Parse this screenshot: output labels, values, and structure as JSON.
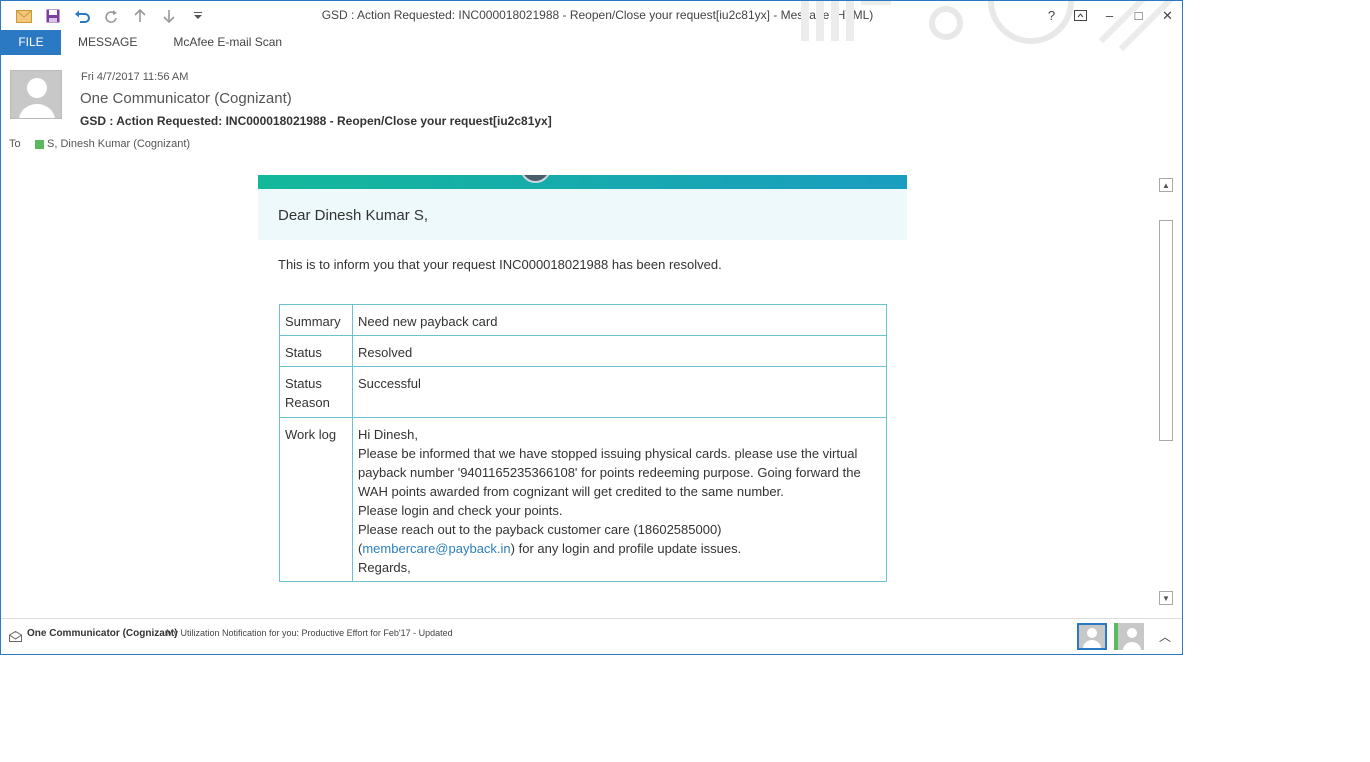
{
  "window": {
    "title": "GSD : Action Requested: INC000018021988 - Reopen/Close your request[iu2c81yx] - Message (HTML)",
    "accent_color": "#2b79c2"
  },
  "quick_access": [
    {
      "icon": "mail-icon"
    },
    {
      "icon": "save-icon"
    },
    {
      "icon": "undo-icon"
    },
    {
      "icon": "redo-icon"
    },
    {
      "icon": "previous-item-icon"
    },
    {
      "icon": "next-item-icon"
    },
    {
      "icon": "customize-toolbar-icon"
    }
  ],
  "window_controls": {
    "help": "?",
    "restore_ribbon_icon": "ribbon-display-icon",
    "minimize": "–",
    "maximize": "□",
    "close": "✕"
  },
  "ribbon": {
    "tabs": [
      "FILE",
      "MESSAGE",
      "McAfee E-mail Scan"
    ]
  },
  "header": {
    "date": "Fri 4/7/2017 11:56 AM",
    "from": "One Communicator (Cognizant)",
    "subject": "GSD : Action Requested: INC000018021988 - Reopen/Close your request[iu2c81yx]",
    "to_label": "To",
    "to": "S, Dinesh Kumar (Cognizant)"
  },
  "email": {
    "greeting": "Dear Dinesh Kumar S,",
    "intro": "This is to inform you that your request INC000018021988 has been resolved.",
    "details": [
      {
        "key": "Summary",
        "value": "Need new payback card"
      },
      {
        "key": "Status",
        "value": "Resolved"
      },
      {
        "key": "Status Reason",
        "value": "Successful"
      }
    ],
    "worklog": {
      "key": "Work log",
      "line1": "Hi Dinesh,",
      "line2": "Please be informed that we have stopped issuing physical cards. please use the virtual payback number '9401165235366108' for points redeeming purpose. Going forward the WAH points awarded from cognizant will get credited to the same number.",
      "line3": "Please login and check your points.",
      "line4_before": "Please reach out to the payback customer care (18602585000) (",
      "link": "membercare@payback.in",
      "line4_after": ") for any login and profile update issues.",
      "line5": "Regards,"
    },
    "banner_color": "#13b89a"
  },
  "people_pane": {
    "sender": "One Communicator (Cognizant)",
    "message": "My Utilization Notification for you: Productive Effort for Feb'17 - Updated"
  }
}
